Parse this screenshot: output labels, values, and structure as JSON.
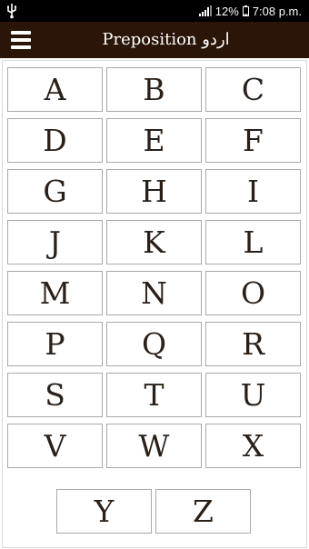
{
  "status": {
    "battery": "12%",
    "time": "7:08 p.m."
  },
  "header": {
    "title": "Preposition اردو",
    "menu_icon": "hamburger-menu-icon"
  },
  "letters": [
    "A",
    "B",
    "C",
    "D",
    "E",
    "F",
    "G",
    "H",
    "I",
    "J",
    "K",
    "L",
    "M",
    "N",
    "O",
    "P",
    "Q",
    "R",
    "S",
    "T",
    "U",
    "V",
    "W",
    "X"
  ],
  "last_row": [
    "Y",
    "Z"
  ],
  "colors": {
    "header_bg": "#2a1508",
    "status_bg": "#000000",
    "letter": "#2a2018",
    "border": "#a9a9a9"
  }
}
